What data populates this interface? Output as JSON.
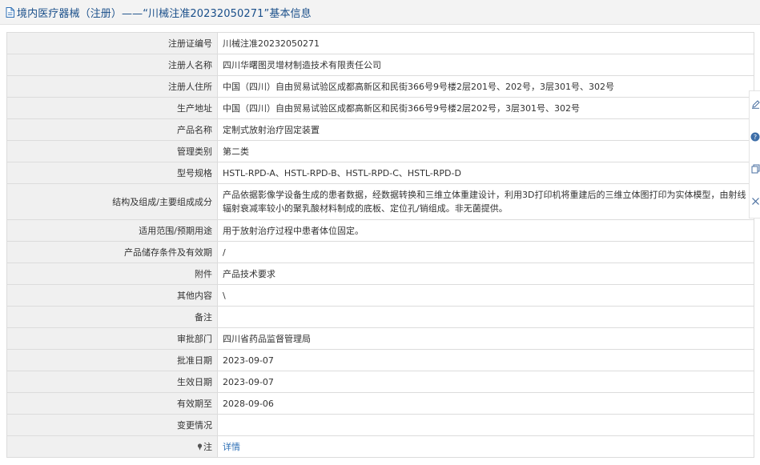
{
  "header": {
    "title": "境内医疗器械（注册）——“川械注准20232050271”基本信息"
  },
  "rows": [
    {
      "label": "注册证编号",
      "value": "川械注准20232050271"
    },
    {
      "label": "注册人名称",
      "value": "四川华曙图灵增材制造技术有限责任公司"
    },
    {
      "label": "注册人住所",
      "value": "中国（四川）自由贸易试验区成都高新区和民街366号9号楼2层201号、202号，3层301号、302号"
    },
    {
      "label": "生产地址",
      "value": "中国（四川）自由贸易试验区成都高新区和民街366号9号楼2层202号，3层301号、302号"
    },
    {
      "label": "产品名称",
      "value": "定制式放射治疗固定装置"
    },
    {
      "label": "管理类别",
      "value": "第二类"
    },
    {
      "label": "型号规格",
      "value": "HSTL-RPD-A、HSTL-RPD-B、HSTL-RPD-C、HSTL-RPD-D"
    },
    {
      "label": "结构及组成/主要组成成分",
      "value": "产品依据影像学设备生成的患者数据，经数据转换和三维立体重建设计，利用3D打印机将重建后的三维立体图打印为实体模型，由射线辐射衰减率较小的聚乳酸材料制成的底板、定位孔/销组成。非无菌提供。"
    },
    {
      "label": "适用范围/预期用途",
      "value": "用于放射治疗过程中患者体位固定。"
    },
    {
      "label": "产品储存条件及有效期",
      "value": "/"
    },
    {
      "label": "附件",
      "value": "产品技术要求"
    },
    {
      "label": "其他内容",
      "value": "\\"
    },
    {
      "label": "备注",
      "value": ""
    },
    {
      "label": "审批部门",
      "value": "四川省药品监督管理局"
    },
    {
      "label": "批准日期",
      "value": "2023-09-07"
    },
    {
      "label": "生效日期",
      "value": "2023-09-07"
    },
    {
      "label": "有效期至",
      "value": "2028-09-06"
    },
    {
      "label": "变更情况",
      "value": ""
    },
    {
      "label": "注",
      "value": "详情"
    }
  ],
  "icons": {
    "title_icon": "document-icon",
    "note_icon": "pin-icon",
    "side": [
      "edit-icon",
      "help-icon",
      "copy-icon",
      "close-icon"
    ]
  },
  "colors": {
    "title": "#1a4f8a",
    "link": "#2d6fb5",
    "label_bg": "#f0f0f0",
    "border": "#dcdcdc"
  }
}
